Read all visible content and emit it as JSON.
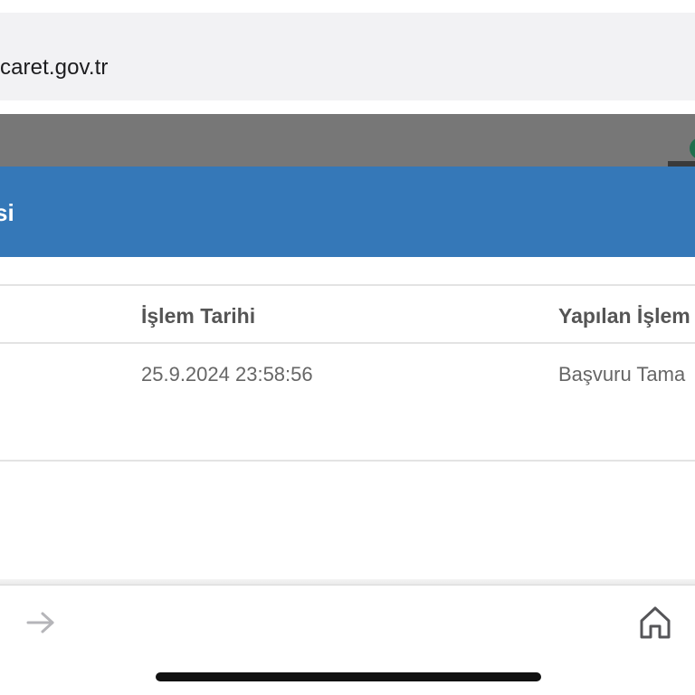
{
  "browser": {
    "address_text": "caret.gov.tr"
  },
  "modal": {
    "title": "si",
    "table": {
      "columns": [
        "İşlem Tarihi",
        "Yapılan İşlem"
      ],
      "rows": [
        [
          "25.9.2024 23:58:56",
          "Başvuru Tama"
        ]
      ]
    }
  },
  "toolbar": {
    "forward_icon": "arrow-right-icon",
    "home_icon": "home-icon"
  },
  "colors": {
    "modal_header": "#3578b8",
    "overlay": "#777777",
    "address_bar": "#f2f2f4"
  }
}
